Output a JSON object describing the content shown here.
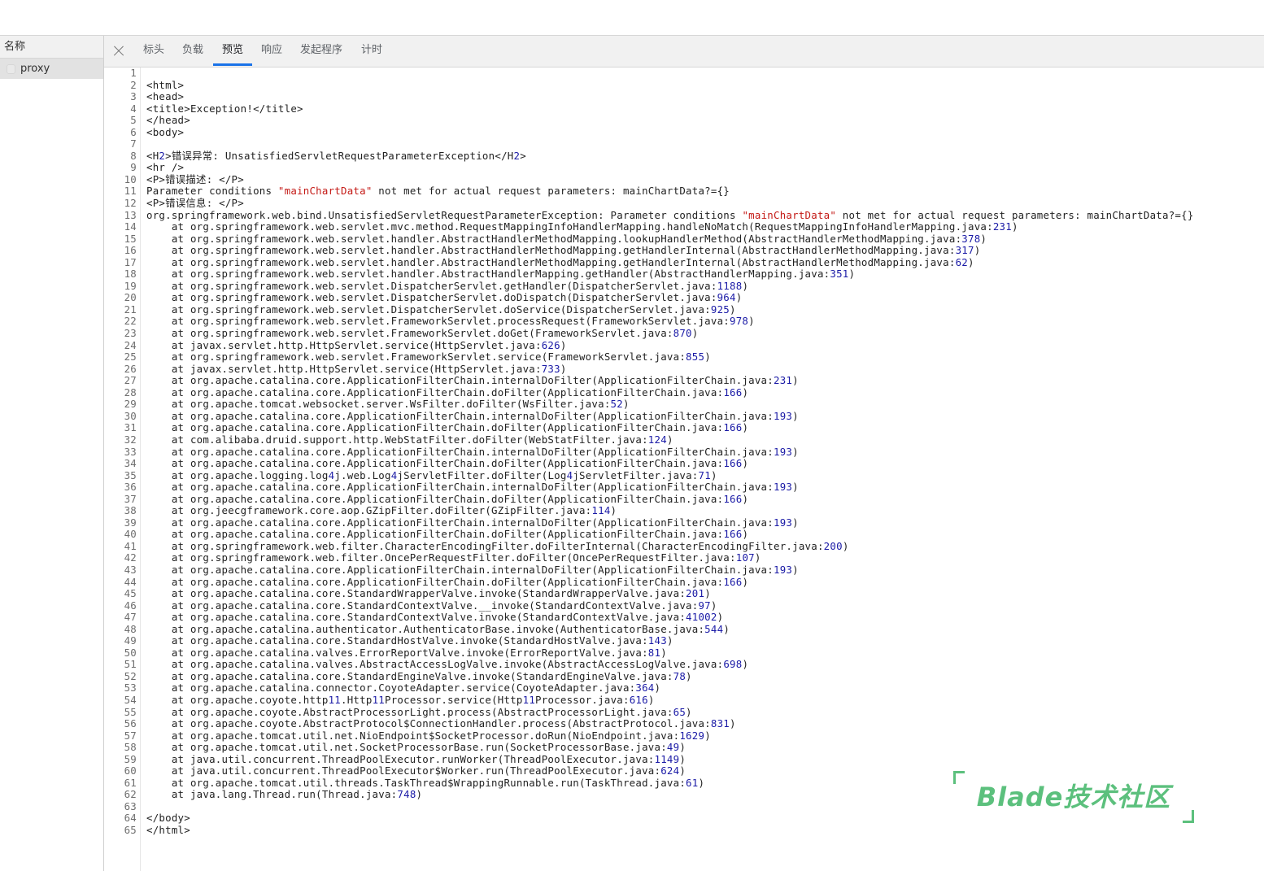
{
  "sidebar": {
    "header": "名称",
    "request": {
      "name": "proxy",
      "icon": "file-icon"
    }
  },
  "tabs": [
    {
      "label": "标头",
      "icon": ""
    },
    {
      "label": "负载"
    },
    {
      "label": "预览",
      "active": true
    },
    {
      "label": "响应"
    },
    {
      "label": "发起程序"
    },
    {
      "label": "计时"
    }
  ],
  "close_icon": "close-icon",
  "colors": {
    "accent": "#1a73e8",
    "number": "#1a1aa6",
    "string": "#c41a16",
    "watermark": "#5cc07d"
  },
  "code_lines": [
    "",
    "<html>",
    "<head>",
    "<title>Exception!</title>",
    "</head>",
    "<body>",
    "",
    "<H2>错误异常: UnsatisfiedServletRequestParameterException</H2>",
    "<hr />",
    "<P>错误描述: </P>",
    "Parameter conditions \"mainChartData\" not met for actual request parameters: mainChartData?={}",
    "<P>错误信息: </P>",
    "org.springframework.web.bind.UnsatisfiedServletRequestParameterException: Parameter conditions \"mainChartData\" not met for actual request parameters: mainChartData?={}",
    "    at org.springframework.web.servlet.mvc.method.RequestMappingInfoHandlerMapping.handleNoMatch(RequestMappingInfoHandlerMapping.java:231)",
    "    at org.springframework.web.servlet.handler.AbstractHandlerMethodMapping.lookupHandlerMethod(AbstractHandlerMethodMapping.java:378)",
    "    at org.springframework.web.servlet.handler.AbstractHandlerMethodMapping.getHandlerInternal(AbstractHandlerMethodMapping.java:317)",
    "    at org.springframework.web.servlet.handler.AbstractHandlerMethodMapping.getHandlerInternal(AbstractHandlerMethodMapping.java:62)",
    "    at org.springframework.web.servlet.handler.AbstractHandlerMapping.getHandler(AbstractHandlerMapping.java:351)",
    "    at org.springframework.web.servlet.DispatcherServlet.getHandler(DispatcherServlet.java:1188)",
    "    at org.springframework.web.servlet.DispatcherServlet.doDispatch(DispatcherServlet.java:964)",
    "    at org.springframework.web.servlet.DispatcherServlet.doService(DispatcherServlet.java:925)",
    "    at org.springframework.web.servlet.FrameworkServlet.processRequest(FrameworkServlet.java:978)",
    "    at org.springframework.web.servlet.FrameworkServlet.doGet(FrameworkServlet.java:870)",
    "    at javax.servlet.http.HttpServlet.service(HttpServlet.java:626)",
    "    at org.springframework.web.servlet.FrameworkServlet.service(FrameworkServlet.java:855)",
    "    at javax.servlet.http.HttpServlet.service(HttpServlet.java:733)",
    "    at org.apache.catalina.core.ApplicationFilterChain.internalDoFilter(ApplicationFilterChain.java:231)",
    "    at org.apache.catalina.core.ApplicationFilterChain.doFilter(ApplicationFilterChain.java:166)",
    "    at org.apache.tomcat.websocket.server.WsFilter.doFilter(WsFilter.java:52)",
    "    at org.apache.catalina.core.ApplicationFilterChain.internalDoFilter(ApplicationFilterChain.java:193)",
    "    at org.apache.catalina.core.ApplicationFilterChain.doFilter(ApplicationFilterChain.java:166)",
    "    at com.alibaba.druid.support.http.WebStatFilter.doFilter(WebStatFilter.java:124)",
    "    at org.apache.catalina.core.ApplicationFilterChain.internalDoFilter(ApplicationFilterChain.java:193)",
    "    at org.apache.catalina.core.ApplicationFilterChain.doFilter(ApplicationFilterChain.java:166)",
    "    at org.apache.logging.log4j.web.Log4jServletFilter.doFilter(Log4jServletFilter.java:71)",
    "    at org.apache.catalina.core.ApplicationFilterChain.internalDoFilter(ApplicationFilterChain.java:193)",
    "    at org.apache.catalina.core.ApplicationFilterChain.doFilter(ApplicationFilterChain.java:166)",
    "    at org.jeecgframework.core.aop.GZipFilter.doFilter(GZipFilter.java:114)",
    "    at org.apache.catalina.core.ApplicationFilterChain.internalDoFilter(ApplicationFilterChain.java:193)",
    "    at org.apache.catalina.core.ApplicationFilterChain.doFilter(ApplicationFilterChain.java:166)",
    "    at org.springframework.web.filter.CharacterEncodingFilter.doFilterInternal(CharacterEncodingFilter.java:200)",
    "    at org.springframework.web.filter.OncePerRequestFilter.doFilter(OncePerRequestFilter.java:107)",
    "    at org.apache.catalina.core.ApplicationFilterChain.internalDoFilter(ApplicationFilterChain.java:193)",
    "    at org.apache.catalina.core.ApplicationFilterChain.doFilter(ApplicationFilterChain.java:166)",
    "    at org.apache.catalina.core.StandardWrapperValve.invoke(StandardWrapperValve.java:201)",
    "    at org.apache.catalina.core.StandardContextValve.__invoke(StandardContextValve.java:97)",
    "    at org.apache.catalina.core.StandardContextValve.invoke(StandardContextValve.java:41002)",
    "    at org.apache.catalina.authenticator.AuthenticatorBase.invoke(AuthenticatorBase.java:544)",
    "    at org.apache.catalina.core.StandardHostValve.invoke(StandardHostValve.java:143)",
    "    at org.apache.catalina.valves.ErrorReportValve.invoke(ErrorReportValve.java:81)",
    "    at org.apache.catalina.valves.AbstractAccessLogValve.invoke(AbstractAccessLogValve.java:698)",
    "    at org.apache.catalina.core.StandardEngineValve.invoke(StandardEngineValve.java:78)",
    "    at org.apache.catalina.connector.CoyoteAdapter.service(CoyoteAdapter.java:364)",
    "    at org.apache.coyote.http11.Http11Processor.service(Http11Processor.java:616)",
    "    at org.apache.coyote.AbstractProcessorLight.process(AbstractProcessorLight.java:65)",
    "    at org.apache.coyote.AbstractProtocol$ConnectionHandler.process(AbstractProtocol.java:831)",
    "    at org.apache.tomcat.util.net.NioEndpoint$SocketProcessor.doRun(NioEndpoint.java:1629)",
    "    at org.apache.tomcat.util.net.SocketProcessorBase.run(SocketProcessorBase.java:49)",
    "    at java.util.concurrent.ThreadPoolExecutor.runWorker(ThreadPoolExecutor.java:1149)",
    "    at java.util.concurrent.ThreadPoolExecutor$Worker.run(ThreadPoolExecutor.java:624)",
    "    at org.apache.tomcat.util.threads.TaskThread$WrappingRunnable.run(TaskThread.java:61)",
    "    at java.lang.Thread.run(Thread.java:748)",
    "",
    "</body>",
    "</html>"
  ],
  "watermark": {
    "text": "Blade技术社区"
  }
}
